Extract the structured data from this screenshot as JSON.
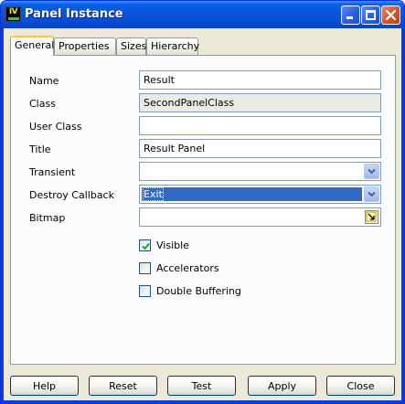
{
  "window": {
    "title": "Panel Instance",
    "app_icon_text": "IV"
  },
  "tabs": [
    {
      "label": "General",
      "active": true
    },
    {
      "label": "Properties",
      "active": false
    },
    {
      "label": "Sizes",
      "active": false
    },
    {
      "label": "Hierarchy",
      "active": false
    }
  ],
  "form": {
    "name": {
      "label": "Name",
      "value": "Result"
    },
    "class": {
      "label": "Class",
      "value": "SecondPanelClass"
    },
    "user_class": {
      "label": "User Class",
      "value": ""
    },
    "title": {
      "label": "Title",
      "value": "Result Panel"
    },
    "transient": {
      "label": "Transient",
      "value": ""
    },
    "destroy_callback": {
      "label": "Destroy Callback",
      "value": "Exit"
    },
    "bitmap": {
      "label": "Bitmap",
      "value": ""
    }
  },
  "checkboxes": [
    {
      "label": "Visible",
      "checked": true
    },
    {
      "label": "Accelerators",
      "checked": false
    },
    {
      "label": "Double Buffering",
      "checked": false
    }
  ],
  "buttons": {
    "help": "Help",
    "reset": "Reset",
    "test": "Test",
    "apply": "Apply",
    "close": "Close"
  },
  "colors": {
    "titlebar": "#0a5fe8",
    "selection": "#316ac5",
    "check": "#21a121"
  }
}
